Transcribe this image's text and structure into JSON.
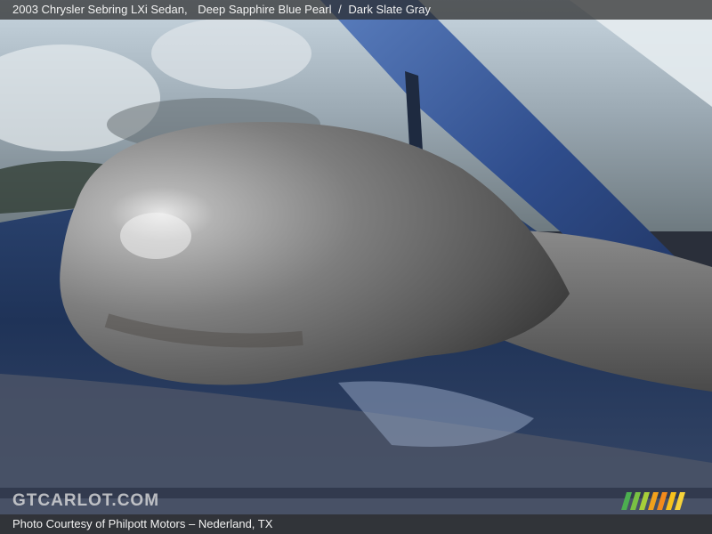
{
  "caption": {
    "year_make_model": "2003 Chrysler Sebring LXi Sedan,",
    "exterior_color": "Deep Sapphire Blue Pearl",
    "separator": "/",
    "interior_color": "Dark Slate Gray"
  },
  "watermark": {
    "text": "GTCARLOT.COM"
  },
  "credit": {
    "text": "Photo Courtesy of Philpott Motors – Nederland, TX"
  },
  "colors": {
    "body_blue": "#2b4270",
    "mirror_gray": "#7d7d7d",
    "overlay_bar": "#282828",
    "stripe_green": "#79c043",
    "stripe_orange": "#f2a11c"
  },
  "photo_subject": "car-side-mirror"
}
